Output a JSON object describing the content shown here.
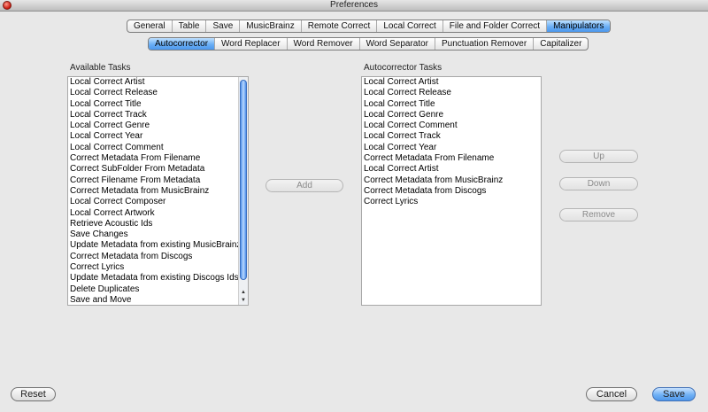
{
  "window": {
    "title": "Preferences"
  },
  "main_tabs": [
    {
      "label": "General"
    },
    {
      "label": "Table"
    },
    {
      "label": "Save"
    },
    {
      "label": "MusicBrainz"
    },
    {
      "label": "Remote Correct"
    },
    {
      "label": "Local Correct"
    },
    {
      "label": "File and Folder Correct"
    },
    {
      "label": "Manipulators",
      "active": true
    }
  ],
  "sub_tabs": [
    {
      "label": "Autocorrector",
      "active": true
    },
    {
      "label": "Word Replacer"
    },
    {
      "label": "Word Remover"
    },
    {
      "label": "Word Separator"
    },
    {
      "label": "Punctuation Remover"
    },
    {
      "label": "Capitalizer"
    }
  ],
  "available_tasks": {
    "label": "Available Tasks",
    "items": [
      "Local Correct Artist",
      "Local Correct Release",
      "Local Correct Title",
      "Local Correct Track",
      "Local Correct Genre",
      "Local Correct Year",
      "Local Correct Comment",
      "Correct Metadata From Filename",
      "Correct SubFolder From Metadata",
      "Correct Filename From Metadata",
      "Correct Metadata from MusicBrainz",
      "Local Correct Composer",
      "Local Correct Artwork",
      "Retrieve Acoustic Ids",
      "Save Changes",
      "Update Metadata from existing MusicBrainz Ids",
      "Correct Metadata from Discogs",
      "Correct Lyrics",
      "Update Metadata from existing Discogs Ids",
      "Delete Duplicates",
      "Save and Move"
    ]
  },
  "autocorrector_tasks": {
    "label": "Autocorrector Tasks",
    "items": [
      "Local Correct Artist",
      "Local Correct Release",
      "Local Correct Title",
      "Local Correct Genre",
      "Local Correct Comment",
      "Local Correct Track",
      "Local Correct Year",
      "Correct Metadata From Filename",
      "Local Correct Artist",
      "Correct Metadata from MusicBrainz",
      "Correct Metadata from Discogs",
      "Correct Lyrics"
    ]
  },
  "buttons": {
    "add": "Add",
    "up": "Up",
    "down": "Down",
    "remove": "Remove",
    "reset": "Reset",
    "cancel": "Cancel",
    "save": "Save"
  },
  "colors": {
    "accent": "#5a9ff0",
    "background": "#e8e8e8",
    "close_button": "#d52a1e"
  },
  "icons": {
    "close": "close-icon",
    "scroll_up": "arrow-up-icon",
    "scroll_down": "arrow-down-icon"
  }
}
